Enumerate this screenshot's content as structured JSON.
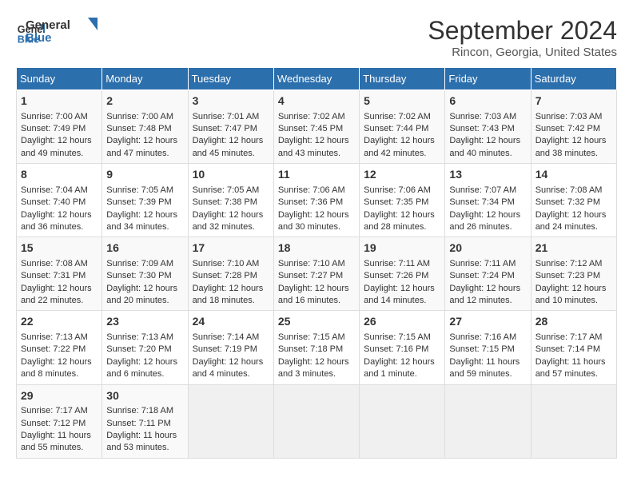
{
  "app": {
    "logo_line1": "General",
    "logo_line2": "Blue"
  },
  "title": "September 2024",
  "subtitle": "Rincon, Georgia, United States",
  "days_of_week": [
    "Sunday",
    "Monday",
    "Tuesday",
    "Wednesday",
    "Thursday",
    "Friday",
    "Saturday"
  ],
  "weeks": [
    [
      {
        "day": "1",
        "sunrise": "Sunrise: 7:00 AM",
        "sunset": "Sunset: 7:49 PM",
        "daylight": "Daylight: 12 hours and 49 minutes."
      },
      {
        "day": "2",
        "sunrise": "Sunrise: 7:00 AM",
        "sunset": "Sunset: 7:48 PM",
        "daylight": "Daylight: 12 hours and 47 minutes."
      },
      {
        "day": "3",
        "sunrise": "Sunrise: 7:01 AM",
        "sunset": "Sunset: 7:47 PM",
        "daylight": "Daylight: 12 hours and 45 minutes."
      },
      {
        "day": "4",
        "sunrise": "Sunrise: 7:02 AM",
        "sunset": "Sunset: 7:45 PM",
        "daylight": "Daylight: 12 hours and 43 minutes."
      },
      {
        "day": "5",
        "sunrise": "Sunrise: 7:02 AM",
        "sunset": "Sunset: 7:44 PM",
        "daylight": "Daylight: 12 hours and 42 minutes."
      },
      {
        "day": "6",
        "sunrise": "Sunrise: 7:03 AM",
        "sunset": "Sunset: 7:43 PM",
        "daylight": "Daylight: 12 hours and 40 minutes."
      },
      {
        "day": "7",
        "sunrise": "Sunrise: 7:03 AM",
        "sunset": "Sunset: 7:42 PM",
        "daylight": "Daylight: 12 hours and 38 minutes."
      }
    ],
    [
      {
        "day": "8",
        "sunrise": "Sunrise: 7:04 AM",
        "sunset": "Sunset: 7:40 PM",
        "daylight": "Daylight: 12 hours and 36 minutes."
      },
      {
        "day": "9",
        "sunrise": "Sunrise: 7:05 AM",
        "sunset": "Sunset: 7:39 PM",
        "daylight": "Daylight: 12 hours and 34 minutes."
      },
      {
        "day": "10",
        "sunrise": "Sunrise: 7:05 AM",
        "sunset": "Sunset: 7:38 PM",
        "daylight": "Daylight: 12 hours and 32 minutes."
      },
      {
        "day": "11",
        "sunrise": "Sunrise: 7:06 AM",
        "sunset": "Sunset: 7:36 PM",
        "daylight": "Daylight: 12 hours and 30 minutes."
      },
      {
        "day": "12",
        "sunrise": "Sunrise: 7:06 AM",
        "sunset": "Sunset: 7:35 PM",
        "daylight": "Daylight: 12 hours and 28 minutes."
      },
      {
        "day": "13",
        "sunrise": "Sunrise: 7:07 AM",
        "sunset": "Sunset: 7:34 PM",
        "daylight": "Daylight: 12 hours and 26 minutes."
      },
      {
        "day": "14",
        "sunrise": "Sunrise: 7:08 AM",
        "sunset": "Sunset: 7:32 PM",
        "daylight": "Daylight: 12 hours and 24 minutes."
      }
    ],
    [
      {
        "day": "15",
        "sunrise": "Sunrise: 7:08 AM",
        "sunset": "Sunset: 7:31 PM",
        "daylight": "Daylight: 12 hours and 22 minutes."
      },
      {
        "day": "16",
        "sunrise": "Sunrise: 7:09 AM",
        "sunset": "Sunset: 7:30 PM",
        "daylight": "Daylight: 12 hours and 20 minutes."
      },
      {
        "day": "17",
        "sunrise": "Sunrise: 7:10 AM",
        "sunset": "Sunset: 7:28 PM",
        "daylight": "Daylight: 12 hours and 18 minutes."
      },
      {
        "day": "18",
        "sunrise": "Sunrise: 7:10 AM",
        "sunset": "Sunset: 7:27 PM",
        "daylight": "Daylight: 12 hours and 16 minutes."
      },
      {
        "day": "19",
        "sunrise": "Sunrise: 7:11 AM",
        "sunset": "Sunset: 7:26 PM",
        "daylight": "Daylight: 12 hours and 14 minutes."
      },
      {
        "day": "20",
        "sunrise": "Sunrise: 7:11 AM",
        "sunset": "Sunset: 7:24 PM",
        "daylight": "Daylight: 12 hours and 12 minutes."
      },
      {
        "day": "21",
        "sunrise": "Sunrise: 7:12 AM",
        "sunset": "Sunset: 7:23 PM",
        "daylight": "Daylight: 12 hours and 10 minutes."
      }
    ],
    [
      {
        "day": "22",
        "sunrise": "Sunrise: 7:13 AM",
        "sunset": "Sunset: 7:22 PM",
        "daylight": "Daylight: 12 hours and 8 minutes."
      },
      {
        "day": "23",
        "sunrise": "Sunrise: 7:13 AM",
        "sunset": "Sunset: 7:20 PM",
        "daylight": "Daylight: 12 hours and 6 minutes."
      },
      {
        "day": "24",
        "sunrise": "Sunrise: 7:14 AM",
        "sunset": "Sunset: 7:19 PM",
        "daylight": "Daylight: 12 hours and 4 minutes."
      },
      {
        "day": "25",
        "sunrise": "Sunrise: 7:15 AM",
        "sunset": "Sunset: 7:18 PM",
        "daylight": "Daylight: 12 hours and 3 minutes."
      },
      {
        "day": "26",
        "sunrise": "Sunrise: 7:15 AM",
        "sunset": "Sunset: 7:16 PM",
        "daylight": "Daylight: 12 hours and 1 minute."
      },
      {
        "day": "27",
        "sunrise": "Sunrise: 7:16 AM",
        "sunset": "Sunset: 7:15 PM",
        "daylight": "Daylight: 11 hours and 59 minutes."
      },
      {
        "day": "28",
        "sunrise": "Sunrise: 7:17 AM",
        "sunset": "Sunset: 7:14 PM",
        "daylight": "Daylight: 11 hours and 57 minutes."
      }
    ],
    [
      {
        "day": "29",
        "sunrise": "Sunrise: 7:17 AM",
        "sunset": "Sunset: 7:12 PM",
        "daylight": "Daylight: 11 hours and 55 minutes."
      },
      {
        "day": "30",
        "sunrise": "Sunrise: 7:18 AM",
        "sunset": "Sunset: 7:11 PM",
        "daylight": "Daylight: 11 hours and 53 minutes."
      },
      null,
      null,
      null,
      null,
      null
    ]
  ]
}
